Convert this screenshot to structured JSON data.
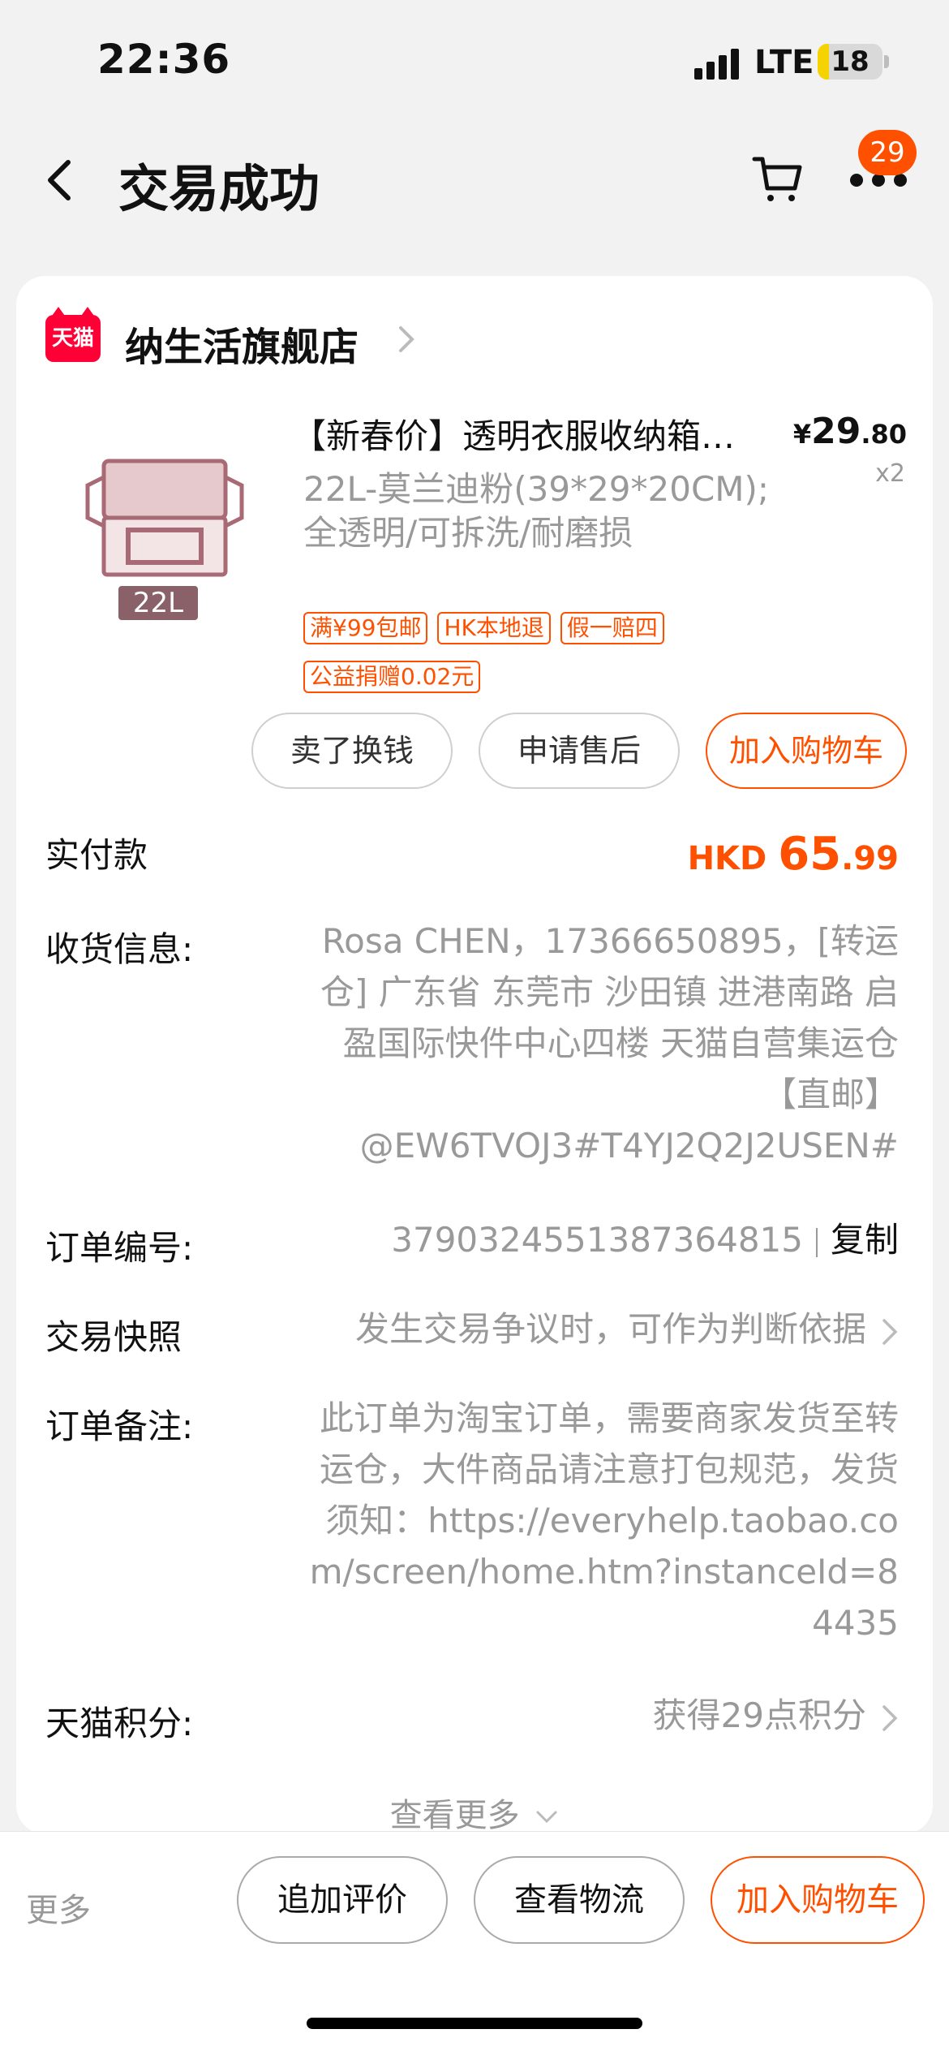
{
  "status_bar": {
    "time": "22:36",
    "network": "LTE",
    "battery": "18",
    "battery_level": 0.18
  },
  "nav": {
    "title": "交易成功",
    "badge_count": "29"
  },
  "shop": {
    "logo_text": "天猫",
    "name": "纳生活旗舰店"
  },
  "product": {
    "title": "【新春价】透明衣服收纳箱…",
    "price_currency": "¥",
    "price_int": "29",
    "price_dec": ".80",
    "quantity": "x2",
    "image_tag": "22L",
    "sku": "22L-莫兰迪粉(39*29*20CM);全透明/可拆洗/耐磨损",
    "tags": [
      "满¥99包邮",
      "HK本地退",
      "假一赔四",
      "公益捐赠0.02元"
    ],
    "actions": [
      "卖了换钱",
      "申请售后",
      "加入购物车"
    ]
  },
  "order": {
    "paid_label": "实付款",
    "paid_currency": "HKD",
    "paid_int": "65",
    "paid_dec": ".99",
    "address_label": "收货信息:",
    "address_value": "Rosa CHEN，17366650895，[转运仓] 广东省 东莞市 沙田镇 进港南路 启盈国际快件中心四楼 天猫自营集运仓【直邮】@EW6TVOJ3#T4YJ2Q2J2USEN#",
    "order_no_label": "订单编号:",
    "order_no_value": "3790324551387364815",
    "copy_label": "复制",
    "snapshot_label": "交易快照",
    "snapshot_value": "发生交易争议时，可作为判断依据",
    "remark_label": "订单备注:",
    "remark_value": "此订单为淘宝订单，需要商家发货至转运仓，大件商品请注意打包规范，发货须知：https://everyhelp.taobao.com/screen/home.htm?instanceId=84435",
    "points_label": "天猫积分:",
    "points_value": "获得29点积分",
    "see_more": "查看更多"
  },
  "bottom_bar": {
    "more": "更多",
    "buttons": [
      "追加评价",
      "查看物流",
      "加入购物车"
    ]
  }
}
